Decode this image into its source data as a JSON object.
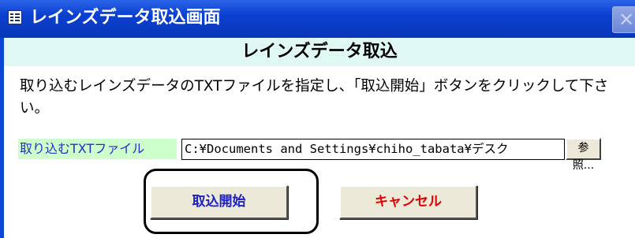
{
  "window": {
    "title": "レインズデータ取込画面",
    "close_icon": "close-icon"
  },
  "header": {
    "title": "レインズデータ取込"
  },
  "instruction": {
    "text": "取り込むレインズデータのTXTファイルを指定し、「取込開始」ボタンをクリックして下さい。"
  },
  "file": {
    "label": "取り込むTXTファイル",
    "value": "C:¥Documents and Settings¥chiho_tabata¥デスク",
    "browse_label": "参照..."
  },
  "buttons": {
    "start_label": "取込開始",
    "cancel_label": "キャンセル"
  },
  "colors": {
    "titlebar": "#0b3fd0",
    "header_band": "#dff8f4",
    "label_bg": "#ccffcc",
    "label_text": "#2a2ad0",
    "start_text": "#1e22c0",
    "cancel_text": "#e00000"
  }
}
